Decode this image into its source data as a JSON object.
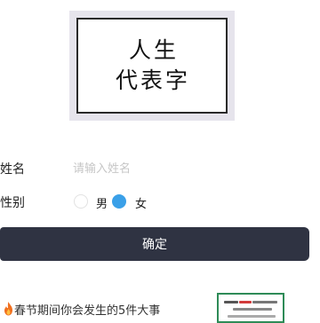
{
  "hero": {
    "line1": "人生",
    "line2": "代表字"
  },
  "form": {
    "name_label": "姓名",
    "name_placeholder": "请输入姓名",
    "name_value": "",
    "gender_label": "性别",
    "gender_options": [
      {
        "label": "男",
        "selected": false
      },
      {
        "label": "女",
        "selected": true
      }
    ],
    "confirm_label": "确定"
  },
  "recommendation": {
    "title": "春节期间你会发生的5件大事",
    "icon": "flame-icon"
  },
  "colors": {
    "button_bg": "#2f3342",
    "radio_selected": "#3aa0e8",
    "thumb_border": "#2e8b57"
  }
}
